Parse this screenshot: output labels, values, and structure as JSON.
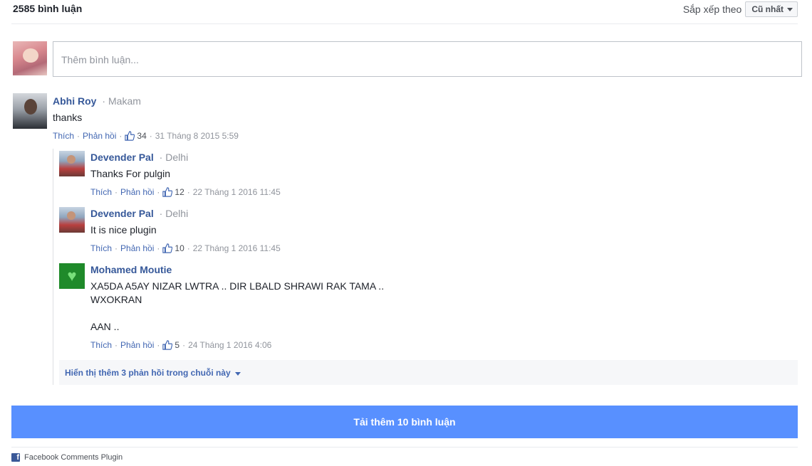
{
  "header": {
    "comment_count": "2585 bình luận",
    "sort_label": "Sắp xếp theo",
    "sort_value": "Cũ nhất"
  },
  "composer": {
    "placeholder": "Thêm bình luận..."
  },
  "comments": [
    {
      "author": "Abhi Roy",
      "location": "Makam",
      "text": "thanks",
      "like_label": "Thích",
      "reply_label": "Phản hồi",
      "likes": "34",
      "timestamp": "31 Tháng 8 2015 5:59"
    }
  ],
  "replies": [
    {
      "author": "Devender Pal",
      "location": "Delhi",
      "text": "Thanks For pulgin",
      "like_label": "Thích",
      "reply_label": "Phản hồi",
      "likes": "12",
      "timestamp": "22 Tháng 1 2016 11:45"
    },
    {
      "author": "Devender Pal",
      "location": "Delhi",
      "text": "It is nice plugin",
      "like_label": "Thích",
      "reply_label": "Phản hồi",
      "likes": "10",
      "timestamp": "22 Tháng 1 2016 11:45"
    },
    {
      "author": "Mohamed Moutie",
      "location": "",
      "text": "XA5DA A5AY NIZAR LWTRA .. DIR LBALD SHRAWI RAK TAMA ..\nWXOKRAN\n\nAAN ..",
      "like_label": "Thích",
      "reply_label": "Phản hồi",
      "likes": "5",
      "timestamp": "24 Tháng 1 2016 4:06"
    }
  ],
  "more_replies_label": "Hiển thị thêm 3 phản hồi trong chuỗi này",
  "load_more_label": "Tải thêm 10 bình luận",
  "footer": {
    "plugin_label": "Facebook Comments Plugin"
  },
  "colors": {
    "link": "#365899",
    "button": "#5890ff",
    "meta": "#90949c"
  }
}
